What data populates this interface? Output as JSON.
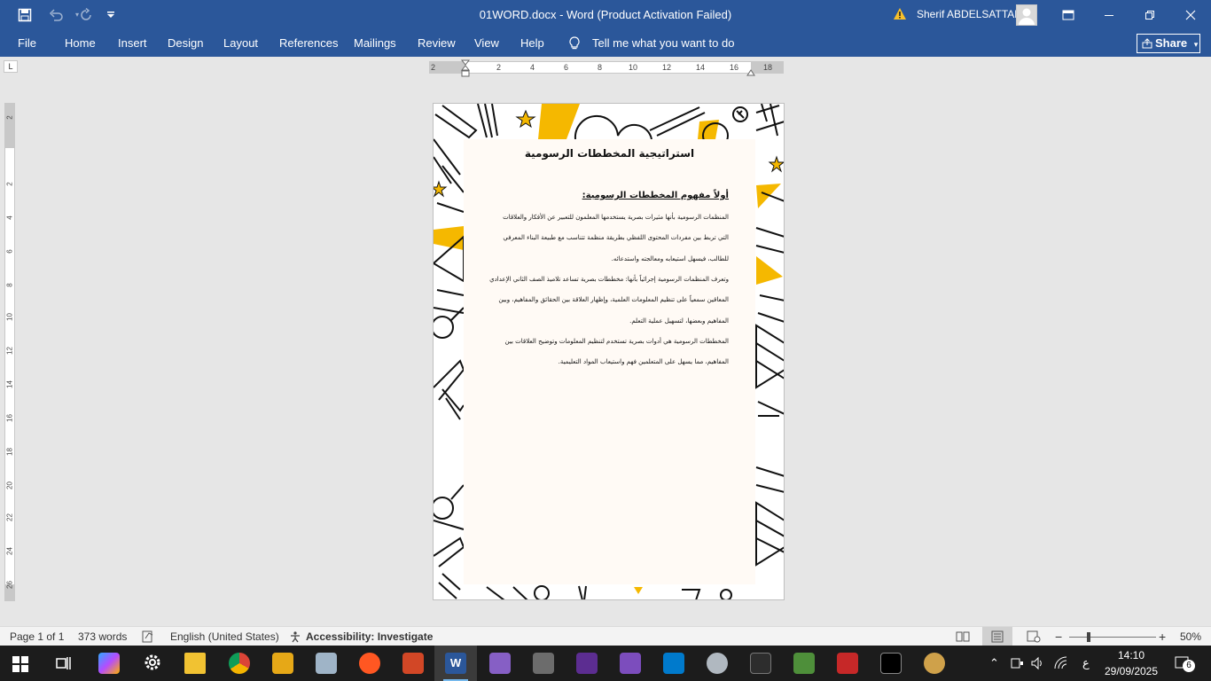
{
  "titlebar": {
    "document_title": "01WORD.docx  -  Word (Product Activation Failed)",
    "user_name": "Sherif ABDELSATTAR"
  },
  "menu": {
    "items": [
      "File",
      "Home",
      "Insert",
      "Design",
      "Layout",
      "References",
      "Mailings",
      "Review",
      "View",
      "Help"
    ],
    "tell_me": "Tell me what you want to do",
    "share": "Share"
  },
  "ruler": {
    "horizontal_numbers": [
      "2",
      "2",
      "4",
      "6",
      "8",
      "10",
      "12",
      "14",
      "16",
      "18"
    ],
    "vertical_numbers": [
      "2",
      "2",
      "4",
      "6",
      "8",
      "10",
      "12",
      "14",
      "16",
      "18",
      "20",
      "22",
      "24",
      "26"
    ],
    "tab_selector": "L"
  },
  "document": {
    "title": "استراتيجية المخططات الرسومية",
    "heading": "أولاً مفهوم المخططات الرسومية:",
    "lines": [
      "المنظمات الرسومية بأنها مثيرات بصرية يستخدمها المعلمون للتعبير عن الأفكار والعلاقات",
      "التي تربط بين مفردات المحتوى اللفظي بطريقة منظمة تتناسب مع طبيعة البناء المعرفي",
      "للطالب، فيسهل استيعابه ومعالجته واستدعائه.",
      "وتعرف المنظمات الرسومية إجرائياً بأنها: مخططات بصرية تساعد تلاميذ الصف الثاني الإعدادي",
      "المعاقين سمعياً على تنظيم المعلومات العلمية، وإظهار العلاقة بين الحقائق والمفاهيم، وبين",
      "المفاهيم وبعضها، لتسهيل عملية التعلم.",
      "المخططات الرسومية هي أدوات بصرية تستخدم لتنظيم المعلومات وتوضيح العلاقات بين",
      "المفاهيم، مما يسهل على المتعلمين فهم واستيعاب المواد التعليمية."
    ]
  },
  "status": {
    "page": "Page 1 of 1",
    "words": "373 words",
    "language": "English (United States)",
    "accessibility": "Accessibility: Investigate",
    "zoom": "50%",
    "zoom_level": 0.5
  },
  "taskbar": {
    "time": "14:10",
    "date": "29/09/2025",
    "lang": "ع",
    "notifications": "6"
  },
  "colors": {
    "word_blue": "#2b579a",
    "accent_yellow": "#f5b800",
    "page_bg": "#fffaf5"
  }
}
